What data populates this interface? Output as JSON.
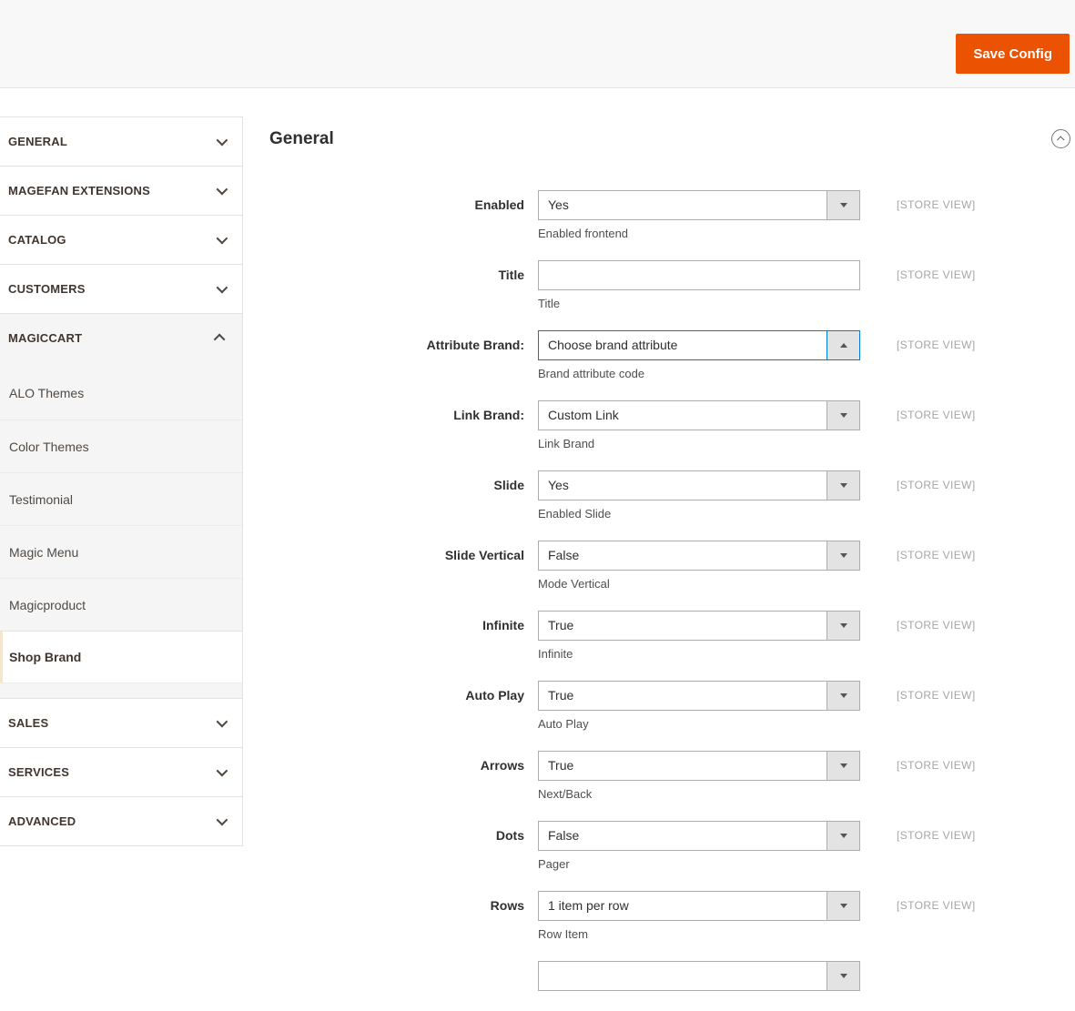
{
  "colors": {
    "accent": "#eb5202",
    "focus_border": "#007bdb"
  },
  "header": {
    "save_button": "Save Config"
  },
  "sidebar": {
    "sections": [
      {
        "label": "GENERAL",
        "state": "collapsed"
      },
      {
        "label": "MAGEFAN EXTENSIONS",
        "state": "collapsed"
      },
      {
        "label": "CATALOG",
        "state": "collapsed"
      },
      {
        "label": "CUSTOMERS",
        "state": "collapsed"
      },
      {
        "label": "MAGICCART",
        "state": "expanded",
        "children": [
          "ALO Themes",
          "Color Themes",
          "Testimonial",
          "Magic Menu",
          "Magicproduct",
          "Shop Brand"
        ],
        "active_child": "Shop Brand"
      },
      {
        "label": "SALES",
        "state": "collapsed"
      },
      {
        "label": "SERVICES",
        "state": "collapsed"
      },
      {
        "label": "ADVANCED",
        "state": "collapsed"
      }
    ]
  },
  "main": {
    "section_title": "General",
    "scope_label": "[STORE VIEW]",
    "fields": [
      {
        "label": "Enabled",
        "type": "select",
        "value": "Yes",
        "helper": "Enabled frontend"
      },
      {
        "label": "Title",
        "type": "text",
        "value": "",
        "helper": "Title"
      },
      {
        "label": "Attribute Brand:",
        "type": "select",
        "value": "Choose brand attribute",
        "focused": true,
        "helper": "Brand attribute code"
      },
      {
        "label": "Link Brand:",
        "type": "select",
        "value": "Custom Link",
        "helper": "Link Brand"
      },
      {
        "label": "Slide",
        "type": "select",
        "value": "Yes",
        "helper": "Enabled Slide"
      },
      {
        "label": "Slide Vertical",
        "type": "select",
        "value": "False",
        "helper": "Mode Vertical"
      },
      {
        "label": "Infinite",
        "type": "select",
        "value": "True",
        "helper": "Infinite"
      },
      {
        "label": "Auto Play",
        "type": "select",
        "value": "True",
        "helper": "Auto Play"
      },
      {
        "label": "Arrows",
        "type": "select",
        "value": "True",
        "helper": "Next/Back"
      },
      {
        "label": "Dots",
        "type": "select",
        "value": "False",
        "helper": "Pager"
      },
      {
        "label": "Rows",
        "type": "select",
        "value": "1 item per row",
        "helper": "Row Item"
      },
      {
        "label": "",
        "type": "select",
        "value": "",
        "helper": "",
        "scope": false,
        "partial": true
      }
    ]
  }
}
